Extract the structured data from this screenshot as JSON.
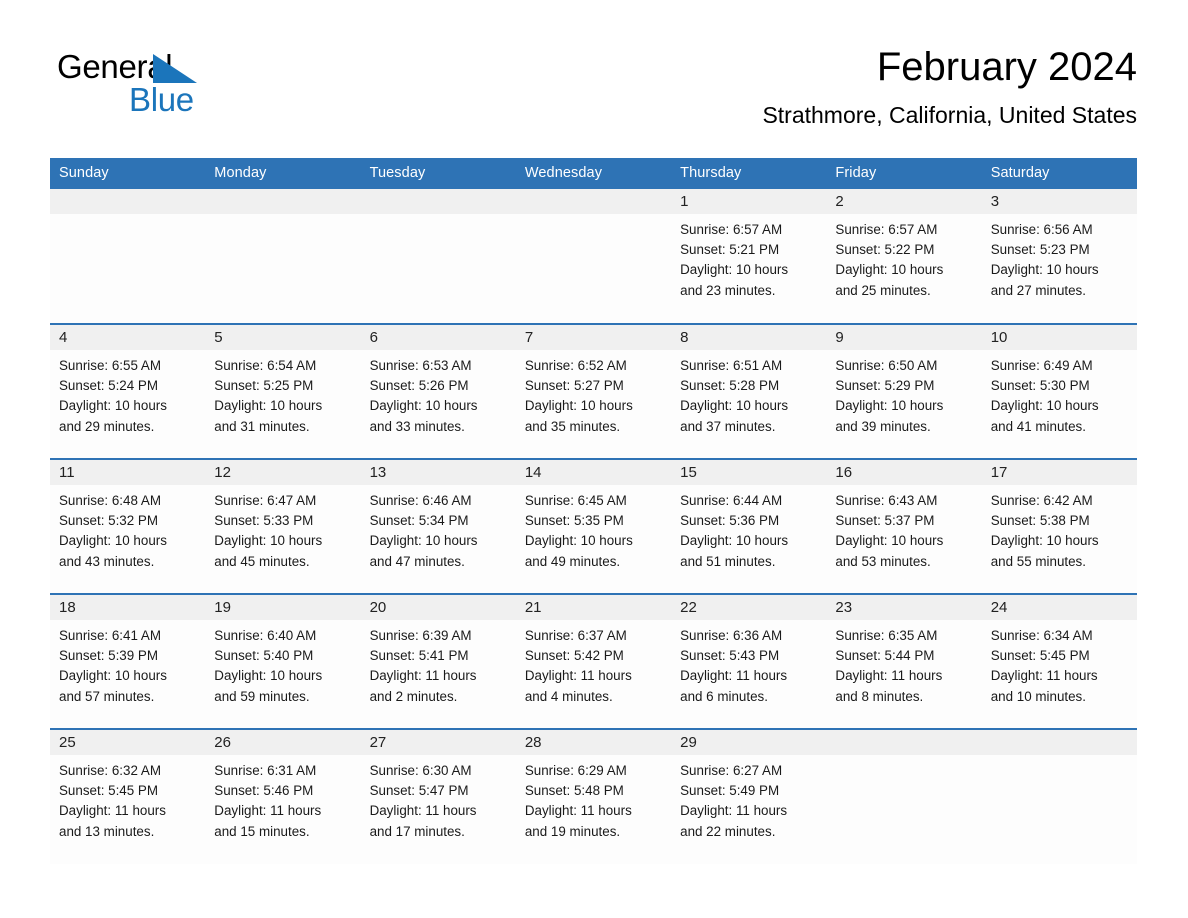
{
  "brand": {
    "name_part1": "General",
    "name_part2": "Blue",
    "logo_icon": "blue-triangle-icon",
    "color_dark": "#000000",
    "color_blue": "#1b75bb"
  },
  "header": {
    "title": "February 2024",
    "subtitle": "Strathmore, California, United States"
  },
  "theme": {
    "header_blue": "#2e73b5",
    "daynum_band": "#f0f0f0",
    "cell_background": "#fdfdfd",
    "text": "#1a1a1a"
  },
  "weekday_headers": [
    "Sunday",
    "Monday",
    "Tuesday",
    "Wednesday",
    "Thursday",
    "Friday",
    "Saturday"
  ],
  "weeks": [
    [
      {
        "day": "",
        "empty": true,
        "sunrise": "",
        "sunset": "",
        "daylight_line1": "",
        "daylight_line2": ""
      },
      {
        "day": "",
        "empty": true,
        "sunrise": "",
        "sunset": "",
        "daylight_line1": "",
        "daylight_line2": ""
      },
      {
        "day": "",
        "empty": true,
        "sunrise": "",
        "sunset": "",
        "daylight_line1": "",
        "daylight_line2": ""
      },
      {
        "day": "",
        "empty": true,
        "sunrise": "",
        "sunset": "",
        "daylight_line1": "",
        "daylight_line2": ""
      },
      {
        "day": "1",
        "empty": false,
        "sunrise": "Sunrise: 6:57 AM",
        "sunset": "Sunset: 5:21 PM",
        "daylight_line1": "Daylight: 10 hours",
        "daylight_line2": "and 23 minutes."
      },
      {
        "day": "2",
        "empty": false,
        "sunrise": "Sunrise: 6:57 AM",
        "sunset": "Sunset: 5:22 PM",
        "daylight_line1": "Daylight: 10 hours",
        "daylight_line2": "and 25 minutes."
      },
      {
        "day": "3",
        "empty": false,
        "sunrise": "Sunrise: 6:56 AM",
        "sunset": "Sunset: 5:23 PM",
        "daylight_line1": "Daylight: 10 hours",
        "daylight_line2": "and 27 minutes."
      }
    ],
    [
      {
        "day": "4",
        "empty": false,
        "sunrise": "Sunrise: 6:55 AM",
        "sunset": "Sunset: 5:24 PM",
        "daylight_line1": "Daylight: 10 hours",
        "daylight_line2": "and 29 minutes."
      },
      {
        "day": "5",
        "empty": false,
        "sunrise": "Sunrise: 6:54 AM",
        "sunset": "Sunset: 5:25 PM",
        "daylight_line1": "Daylight: 10 hours",
        "daylight_line2": "and 31 minutes."
      },
      {
        "day": "6",
        "empty": false,
        "sunrise": "Sunrise: 6:53 AM",
        "sunset": "Sunset: 5:26 PM",
        "daylight_line1": "Daylight: 10 hours",
        "daylight_line2": "and 33 minutes."
      },
      {
        "day": "7",
        "empty": false,
        "sunrise": "Sunrise: 6:52 AM",
        "sunset": "Sunset: 5:27 PM",
        "daylight_line1": "Daylight: 10 hours",
        "daylight_line2": "and 35 minutes."
      },
      {
        "day": "8",
        "empty": false,
        "sunrise": "Sunrise: 6:51 AM",
        "sunset": "Sunset: 5:28 PM",
        "daylight_line1": "Daylight: 10 hours",
        "daylight_line2": "and 37 minutes."
      },
      {
        "day": "9",
        "empty": false,
        "sunrise": "Sunrise: 6:50 AM",
        "sunset": "Sunset: 5:29 PM",
        "daylight_line1": "Daylight: 10 hours",
        "daylight_line2": "and 39 minutes."
      },
      {
        "day": "10",
        "empty": false,
        "sunrise": "Sunrise: 6:49 AM",
        "sunset": "Sunset: 5:30 PM",
        "daylight_line1": "Daylight: 10 hours",
        "daylight_line2": "and 41 minutes."
      }
    ],
    [
      {
        "day": "11",
        "empty": false,
        "sunrise": "Sunrise: 6:48 AM",
        "sunset": "Sunset: 5:32 PM",
        "daylight_line1": "Daylight: 10 hours",
        "daylight_line2": "and 43 minutes."
      },
      {
        "day": "12",
        "empty": false,
        "sunrise": "Sunrise: 6:47 AM",
        "sunset": "Sunset: 5:33 PM",
        "daylight_line1": "Daylight: 10 hours",
        "daylight_line2": "and 45 minutes."
      },
      {
        "day": "13",
        "empty": false,
        "sunrise": "Sunrise: 6:46 AM",
        "sunset": "Sunset: 5:34 PM",
        "daylight_line1": "Daylight: 10 hours",
        "daylight_line2": "and 47 minutes."
      },
      {
        "day": "14",
        "empty": false,
        "sunrise": "Sunrise: 6:45 AM",
        "sunset": "Sunset: 5:35 PM",
        "daylight_line1": "Daylight: 10 hours",
        "daylight_line2": "and 49 minutes."
      },
      {
        "day": "15",
        "empty": false,
        "sunrise": "Sunrise: 6:44 AM",
        "sunset": "Sunset: 5:36 PM",
        "daylight_line1": "Daylight: 10 hours",
        "daylight_line2": "and 51 minutes."
      },
      {
        "day": "16",
        "empty": false,
        "sunrise": "Sunrise: 6:43 AM",
        "sunset": "Sunset: 5:37 PM",
        "daylight_line1": "Daylight: 10 hours",
        "daylight_line2": "and 53 minutes."
      },
      {
        "day": "17",
        "empty": false,
        "sunrise": "Sunrise: 6:42 AM",
        "sunset": "Sunset: 5:38 PM",
        "daylight_line1": "Daylight: 10 hours",
        "daylight_line2": "and 55 minutes."
      }
    ],
    [
      {
        "day": "18",
        "empty": false,
        "sunrise": "Sunrise: 6:41 AM",
        "sunset": "Sunset: 5:39 PM",
        "daylight_line1": "Daylight: 10 hours",
        "daylight_line2": "and 57 minutes."
      },
      {
        "day": "19",
        "empty": false,
        "sunrise": "Sunrise: 6:40 AM",
        "sunset": "Sunset: 5:40 PM",
        "daylight_line1": "Daylight: 10 hours",
        "daylight_line2": "and 59 minutes."
      },
      {
        "day": "20",
        "empty": false,
        "sunrise": "Sunrise: 6:39 AM",
        "sunset": "Sunset: 5:41 PM",
        "daylight_line1": "Daylight: 11 hours",
        "daylight_line2": "and 2 minutes."
      },
      {
        "day": "21",
        "empty": false,
        "sunrise": "Sunrise: 6:37 AM",
        "sunset": "Sunset: 5:42 PM",
        "daylight_line1": "Daylight: 11 hours",
        "daylight_line2": "and 4 minutes."
      },
      {
        "day": "22",
        "empty": false,
        "sunrise": "Sunrise: 6:36 AM",
        "sunset": "Sunset: 5:43 PM",
        "daylight_line1": "Daylight: 11 hours",
        "daylight_line2": "and 6 minutes."
      },
      {
        "day": "23",
        "empty": false,
        "sunrise": "Sunrise: 6:35 AM",
        "sunset": "Sunset: 5:44 PM",
        "daylight_line1": "Daylight: 11 hours",
        "daylight_line2": "and 8 minutes."
      },
      {
        "day": "24",
        "empty": false,
        "sunrise": "Sunrise: 6:34 AM",
        "sunset": "Sunset: 5:45 PM",
        "daylight_line1": "Daylight: 11 hours",
        "daylight_line2": "and 10 minutes."
      }
    ],
    [
      {
        "day": "25",
        "empty": false,
        "sunrise": "Sunrise: 6:32 AM",
        "sunset": "Sunset: 5:45 PM",
        "daylight_line1": "Daylight: 11 hours",
        "daylight_line2": "and 13 minutes."
      },
      {
        "day": "26",
        "empty": false,
        "sunrise": "Sunrise: 6:31 AM",
        "sunset": "Sunset: 5:46 PM",
        "daylight_line1": "Daylight: 11 hours",
        "daylight_line2": "and 15 minutes."
      },
      {
        "day": "27",
        "empty": false,
        "sunrise": "Sunrise: 6:30 AM",
        "sunset": "Sunset: 5:47 PM",
        "daylight_line1": "Daylight: 11 hours",
        "daylight_line2": "and 17 minutes."
      },
      {
        "day": "28",
        "empty": false,
        "sunrise": "Sunrise: 6:29 AM",
        "sunset": "Sunset: 5:48 PM",
        "daylight_line1": "Daylight: 11 hours",
        "daylight_line2": "and 19 minutes."
      },
      {
        "day": "29",
        "empty": false,
        "sunrise": "Sunrise: 6:27 AM",
        "sunset": "Sunset: 5:49 PM",
        "daylight_line1": "Daylight: 11 hours",
        "daylight_line2": "and 22 minutes."
      },
      {
        "day": "",
        "empty": true,
        "sunrise": "",
        "sunset": "",
        "daylight_line1": "",
        "daylight_line2": ""
      },
      {
        "day": "",
        "empty": true,
        "sunrise": "",
        "sunset": "",
        "daylight_line1": "",
        "daylight_line2": ""
      }
    ]
  ]
}
